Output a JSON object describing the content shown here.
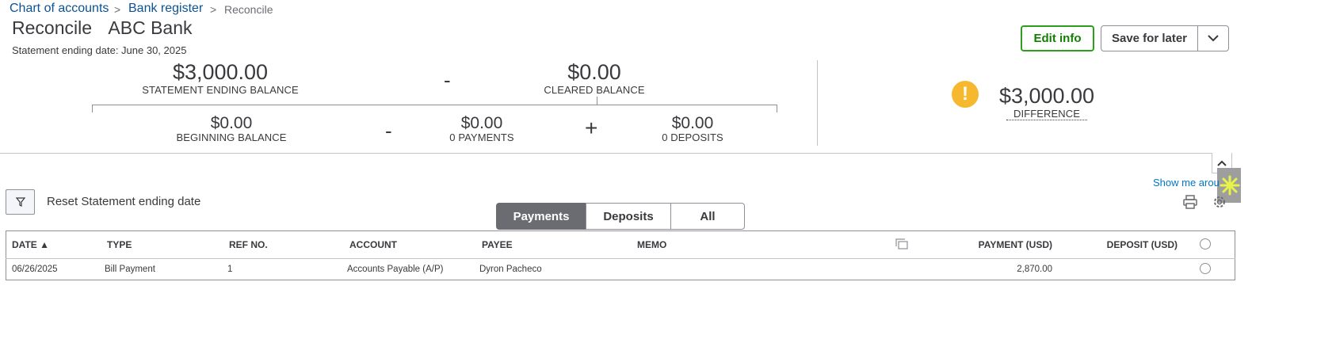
{
  "breadcrumb": {
    "items": [
      "Chart of accounts",
      "Bank register",
      "Reconcile"
    ],
    "separator": ">"
  },
  "header": {
    "title": "Reconcile",
    "account": "ABC Bank",
    "statement_date": "Statement ending date: June 30, 2025",
    "edit_info": "Edit info",
    "save_for_later": "Save for later"
  },
  "summary": {
    "statement_ending_balance": "$3,000.00",
    "statement_ending_balance_label": "STATEMENT ENDING BALANCE",
    "minus_op": "-",
    "cleared_balance": "$0.00",
    "cleared_balance_label": "CLEARED BALANCE",
    "beginning_balance": "$0.00",
    "beginning_balance_label": "BEGINNING BALANCE",
    "payments": "$0.00",
    "payments_label": "0 PAYMENTS",
    "plus_op": "+",
    "deposits": "$0.00",
    "deposits_label": "0 DEPOSITS",
    "difference": "$3,000.00",
    "difference_label": "DIFFERENCE",
    "warning_symbol": "!"
  },
  "toolbar": {
    "reset_label": "Reset Statement ending date",
    "tabs": [
      "Payments",
      "Deposits",
      "All"
    ],
    "active_tab": "Payments",
    "show_me": "Show me arou"
  },
  "table": {
    "columns": {
      "date": "DATE ▲",
      "type": "TYPE",
      "ref": "REF NO.",
      "account": "ACCOUNT",
      "payee": "PAYEE",
      "memo": "MEMO",
      "payment": "PAYMENT (USD)",
      "deposit": "DEPOSIT (USD)"
    },
    "rows": [
      {
        "date": "06/26/2025",
        "type": "Bill Payment",
        "ref": "1",
        "account": "Accounts Payable (A/P)",
        "payee": "Dyron Pacheco",
        "memo": "",
        "payment": "2,870.00",
        "deposit": ""
      }
    ]
  },
  "colors": {
    "link": "#0b5394",
    "primary_green": "#2ca01c",
    "warning": "#f5b82e",
    "active_tab_bg": "#6b6c72",
    "border": "#8d9096"
  },
  "icons": [
    "filter-icon",
    "print-icon",
    "gear-icon",
    "chevron-up-icon",
    "chevron-down-icon",
    "columns-icon",
    "assistant-icon",
    "warning-icon"
  ]
}
